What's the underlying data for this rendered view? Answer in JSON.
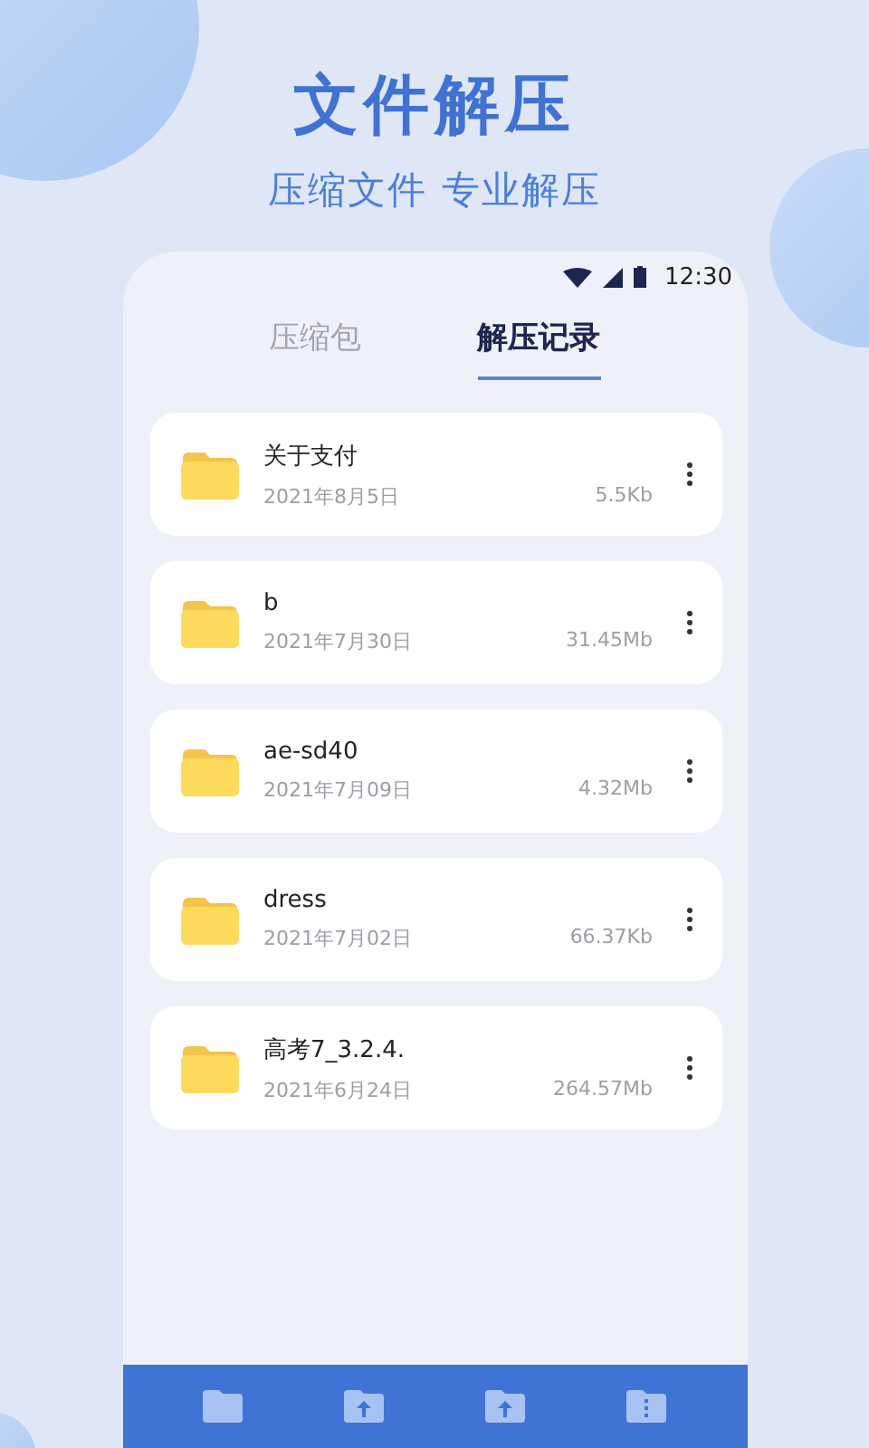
{
  "header": {
    "title": "文件解压",
    "subtitle": "压缩文件 专业解压"
  },
  "status_bar": {
    "time": "12:30"
  },
  "tabs": [
    {
      "label": "压缩包",
      "selected": false
    },
    {
      "label": "解压记录",
      "selected": true
    }
  ],
  "files": [
    {
      "name": "关于支付",
      "date": "2021年8月5日",
      "size": "5.5Kb"
    },
    {
      "name": "b",
      "date": "2021年7月30日",
      "size": "31.45Mb"
    },
    {
      "name": "ae-sd40",
      "date": "2021年7月09日",
      "size": "4.32Mb"
    },
    {
      "name": "dress",
      "date": "2021年7月02日",
      "size": "66.37Kb"
    },
    {
      "name": "高考7_3.2.4.",
      "date": "2021年6月24日",
      "size": "264.57Mb"
    }
  ],
  "bottom_nav": [
    {
      "kind": "folder"
    },
    {
      "kind": "upload"
    },
    {
      "kind": "upload"
    },
    {
      "kind": "compress"
    }
  ]
}
